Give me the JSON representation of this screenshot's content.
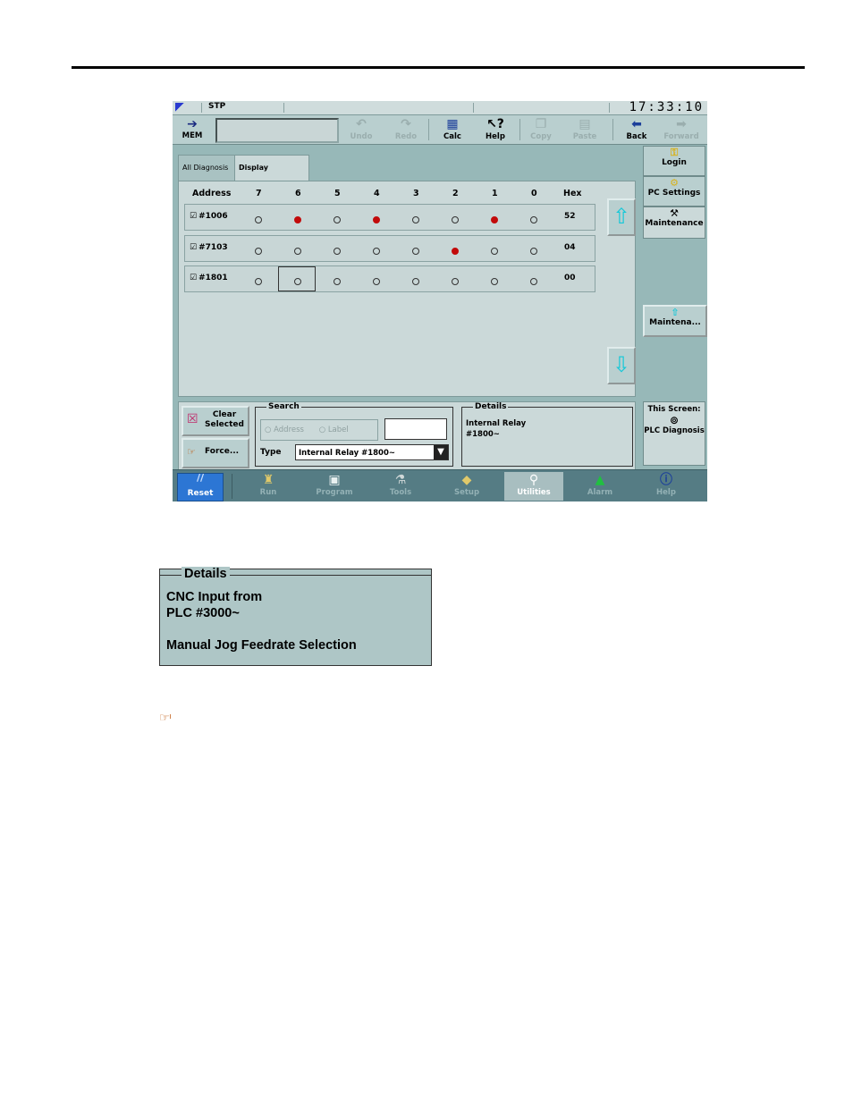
{
  "status_bar": {
    "mode": "STP",
    "clock": "17:33:10"
  },
  "toolbar": {
    "mem_label": "MEM",
    "buttons": [
      {
        "label": "Undo",
        "icon": "undo-icon",
        "enabled": false
      },
      {
        "label": "Redo",
        "icon": "redo-icon",
        "enabled": false
      },
      {
        "label": "Calc",
        "icon": "calculator-icon",
        "enabled": true
      },
      {
        "label": "Help",
        "icon": "help-pointer-icon",
        "enabled": true
      },
      {
        "label": "Copy",
        "icon": "copy-icon",
        "enabled": false
      },
      {
        "label": "Paste",
        "icon": "paste-icon",
        "enabled": false
      },
      {
        "label": "Back",
        "icon": "back-arrow-icon",
        "enabled": true
      },
      {
        "label": "Forward",
        "icon": "forward-arrow-icon",
        "enabled": false
      }
    ]
  },
  "tabs": [
    {
      "label": "All Diagnosis",
      "active": false
    },
    {
      "label": "Display Selected",
      "active": true
    }
  ],
  "grid": {
    "address_header": "Address",
    "bit_headers": [
      "7",
      "6",
      "5",
      "4",
      "3",
      "2",
      "1",
      "0"
    ],
    "hex_header": "Hex",
    "rows": [
      {
        "address": "#1006",
        "checked": true,
        "bits": [
          0,
          1,
          0,
          1,
          0,
          0,
          1,
          0
        ],
        "hex": "52"
      },
      {
        "address": "#7103",
        "checked": true,
        "bits": [
          0,
          0,
          0,
          0,
          0,
          1,
          0,
          0
        ],
        "hex": "04"
      },
      {
        "address": "#1801",
        "checked": true,
        "bits": [
          0,
          0,
          0,
          0,
          0,
          0,
          0,
          0
        ],
        "hex": "00"
      }
    ]
  },
  "side_menu": {
    "login": "Login",
    "pc_settings": "PC Settings",
    "maintenance": "Maintenance",
    "maintenance_short": "Maintena...",
    "this_screen_title": "This Screen:",
    "this_screen_value": "PLC Diagnosis"
  },
  "bottom_panel": {
    "clear_selected": "Clear Selected",
    "force": "Force...",
    "search_legend": "Search",
    "radio_address": "Address",
    "radio_label": "Label",
    "type_label": "Type",
    "type_value": "Internal Relay #1800~",
    "details_legend": "Details",
    "details_text": "Internal Relay\n#1800~"
  },
  "nav_bar": {
    "reset": "Reset",
    "items": [
      {
        "label": "Run",
        "active": false
      },
      {
        "label": "Program",
        "active": false
      },
      {
        "label": "Tools",
        "active": false
      },
      {
        "label": "Setup",
        "active": false
      },
      {
        "label": "Utilities",
        "active": true
      },
      {
        "label": "Alarm",
        "active": false
      },
      {
        "label": "Help",
        "active": false
      }
    ]
  },
  "details_example": {
    "title": "Details",
    "text": "CNC Input from\nPLC #3000~\n\nManual Jog Feedrate Selection"
  },
  "colors": {
    "panel": "#cbd9d9",
    "frame": "#97b8b8",
    "bit_on": "#c20a0a",
    "nav": "#557c84",
    "reset": "#2c76d4",
    "arrow": "#14c8d8"
  }
}
